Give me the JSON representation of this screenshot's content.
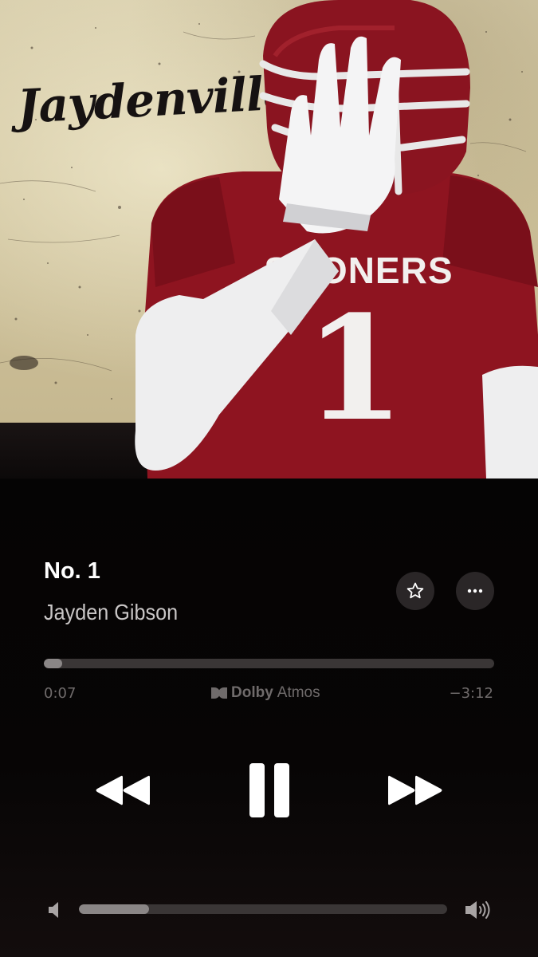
{
  "artwork": {
    "brand_text": "Jaydenville",
    "jersey_lettering": "SOONERS",
    "jersey_number": "1"
  },
  "track": {
    "title": "No. 1",
    "artist": "Jayden Gibson"
  },
  "playback": {
    "elapsed": "0:07",
    "remaining": "−3:12",
    "progress_fraction": 0.04,
    "state": "playing"
  },
  "audio_badge": {
    "brand": "Dolby",
    "format": "Atmos"
  },
  "volume": {
    "level_fraction": 0.19
  },
  "icons": {
    "favorite": "star-outline-icon",
    "more": "ellipsis-icon",
    "rewind": "rewind-icon",
    "pause": "pause-icon",
    "fast_forward": "fast-forward-icon",
    "volume_low": "speaker-low-icon",
    "volume_high": "speaker-high-icon"
  },
  "colors": {
    "background": "#060405",
    "jersey_crimson": "#8e1420",
    "track_bg": "#3a3636",
    "track_fill": "#8a8686",
    "secondary_text": "#6f6b6b"
  }
}
